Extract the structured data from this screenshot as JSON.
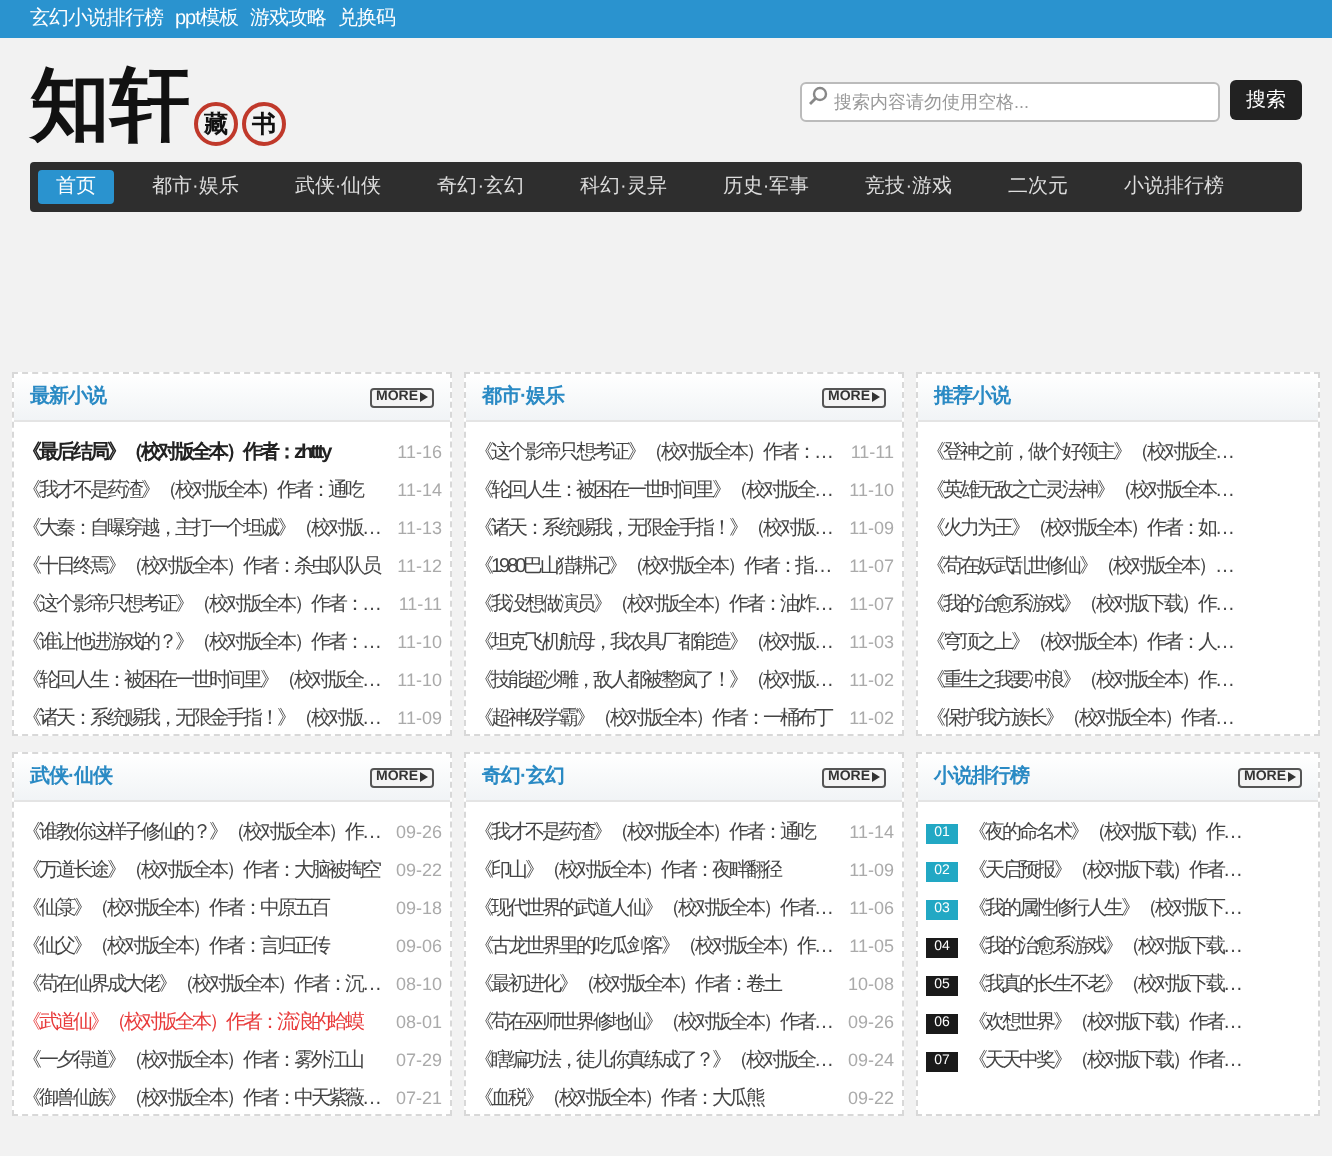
{
  "top_links": [
    "玄幻小说排行榜",
    "ppt模板",
    "游戏攻略",
    "兑换码"
  ],
  "logo": {
    "main": "知轩",
    "seals": [
      "藏",
      "书"
    ]
  },
  "search": {
    "placeholder": "搜索内容请勿使用空格...",
    "button": "搜索"
  },
  "nav": [
    {
      "label": "首页",
      "selected": true
    },
    {
      "label": "都市·娱乐",
      "selected": false
    },
    {
      "label": "武侠·仙侠",
      "selected": false
    },
    {
      "label": "奇幻·玄幻",
      "selected": false
    },
    {
      "label": "科幻·灵异",
      "selected": false
    },
    {
      "label": "历史·军事",
      "selected": false
    },
    {
      "label": "竞技·游戏",
      "selected": false
    },
    {
      "label": "二次元",
      "selected": false
    },
    {
      "label": "小说排行榜",
      "selected": false
    }
  ],
  "panels": [
    {
      "kind": "dated",
      "title": "最新小说",
      "more": "MORE",
      "items": [
        {
          "text": "《最后结局》（校对版全本）作者：zhttty",
          "date": "11-16",
          "bold": true,
          "highlighted": false
        },
        {
          "text": "《我才不是药渣》（校对版全本）作者：通吃",
          "date": "11-14",
          "bold": false,
          "highlighted": false
        },
        {
          "text": "《大秦：自曝穿越，主打一个坦诚》（校对版…",
          "date": "11-13",
          "bold": false,
          "highlighted": false
        },
        {
          "text": "《十日终焉》（校对版全本）作者：杀虫队队员",
          "date": "11-12",
          "bold": false,
          "highlighted": false
        },
        {
          "text": "《这个影帝只想考证》（校对版全本）作者：…",
          "date": "11-11",
          "bold": false,
          "highlighted": false
        },
        {
          "text": "《谁让他进游戏的？》（校对版全本）作者：…",
          "date": "11-10",
          "bold": false,
          "highlighted": false
        },
        {
          "text": "《轮回人生：被困在一世时间里》（校对版全…",
          "date": "11-10",
          "bold": false,
          "highlighted": false
        },
        {
          "text": "《诸天：系统赐我，无限金手指！》（校对版…",
          "date": "11-09",
          "bold": false,
          "highlighted": false
        }
      ]
    },
    {
      "kind": "dated",
      "title": "都市·娱乐",
      "more": "MORE",
      "items": [
        {
          "text": "《这个影帝只想考证》（校对版全本）作者：…",
          "date": "11-11",
          "bold": false,
          "highlighted": false
        },
        {
          "text": "《轮回人生：被困在一世时间里》（校对版全…",
          "date": "11-10",
          "bold": false,
          "highlighted": false
        },
        {
          "text": "《诸天：系统赐我，无限金手指！》（校对版…",
          "date": "11-09",
          "bold": false,
          "highlighted": false
        },
        {
          "text": "《1980巴山猎耕记》（校对版全本）作者：指…",
          "date": "11-07",
          "bold": false,
          "highlighted": false
        },
        {
          "text": "《我没想做演员》（校对版全本）作者：油炸…",
          "date": "11-07",
          "bold": false,
          "highlighted": false
        },
        {
          "text": "《坦克飞机航母，我农具厂都能造》（校对版…",
          "date": "11-03",
          "bold": false,
          "highlighted": false
        },
        {
          "text": "《技能超沙雕，敌人都被整疯了！》（校对版…",
          "date": "11-02",
          "bold": false,
          "highlighted": false
        },
        {
          "text": "《超神级学霸》（校对版全本）作者：一桶布丁",
          "date": "11-02",
          "bold": false,
          "highlighted": false
        }
      ]
    },
    {
      "kind": "plain",
      "title": "推荐小说",
      "items": [
        {
          "text": "《登神之前，做个好领主》（校对版全…"
        },
        {
          "text": "《英雄无敌之亡灵法神》（校对版全本…"
        },
        {
          "text": "《火力为王》（校对版全本）作者：如…"
        },
        {
          "text": "《苟在妖武乱世修仙》（校对版全本）…"
        },
        {
          "text": "《我的治愈系游戏》（校对版下载）作…"
        },
        {
          "text": "《穹顶之上》（校对版全本）作者：人…"
        },
        {
          "text": "《重生之我要冲浪》（校对版全本）作…"
        },
        {
          "text": "《保护我方族长》（校对版全本）作者…"
        }
      ]
    },
    {
      "kind": "dated",
      "title": "武侠·仙侠",
      "more": "MORE",
      "items": [
        {
          "text": "《谁教你这样子修仙的？》（校对版全本）作…",
          "date": "09-26",
          "bold": false,
          "highlighted": false
        },
        {
          "text": "《万道长途》（校对版全本）作者：大脑被掏空",
          "date": "09-22",
          "bold": false,
          "highlighted": false
        },
        {
          "text": "《仙箓》（校对版全本）作者：中原五百",
          "date": "09-18",
          "bold": false,
          "highlighted": false
        },
        {
          "text": "《仙父》（校对版全本）作者：言归正传",
          "date": "09-06",
          "bold": false,
          "highlighted": false
        },
        {
          "text": "《苟在仙界成大佬》（校对版全本）作者：沉…",
          "date": "08-10",
          "bold": false,
          "highlighted": false
        },
        {
          "text": "《武道仙》（校对版全本）作者：流浪的蛤蟆",
          "date": "08-01",
          "bold": false,
          "highlighted": true
        },
        {
          "text": "《一夕得道》（校对版全本）作者：雾外江山",
          "date": "07-29",
          "bold": false,
          "highlighted": false
        },
        {
          "text": "《御兽仙族》（校对版全本）作者：中天紫薇…",
          "date": "07-21",
          "bold": false,
          "highlighted": false
        }
      ]
    },
    {
      "kind": "dated",
      "title": "奇幻·玄幻",
      "more": "MORE",
      "items": [
        {
          "text": "《我才不是药渣》（校对版全本）作者：通吃",
          "date": "11-14",
          "bold": false,
          "highlighted": false
        },
        {
          "text": "《印山》（校对版全本）作者：夜畔翻径",
          "date": "11-09",
          "bold": false,
          "highlighted": false
        },
        {
          "text": "《现代世界的武道人仙》（校对版全本）作者…",
          "date": "11-06",
          "bold": false,
          "highlighted": false
        },
        {
          "text": "《古龙世界里的吃瓜剑客》（校对版全本）作…",
          "date": "11-05",
          "bold": false,
          "highlighted": false
        },
        {
          "text": "《最初进化》（校对版全本）作者：卷土",
          "date": "10-08",
          "bold": false,
          "highlighted": false
        },
        {
          "text": "《苟在巫师世界修地仙》（校对版全本）作者…",
          "date": "09-26",
          "bold": false,
          "highlighted": false
        },
        {
          "text": "《瞎编功法，徒儿你真练成了？》（校对版全…",
          "date": "09-24",
          "bold": false,
          "highlighted": false
        },
        {
          "text": "《血税》（校对版全本）作者：大瓜熊",
          "date": "09-22",
          "bold": false,
          "highlighted": false
        }
      ]
    },
    {
      "kind": "ranked",
      "title": "小说排行榜",
      "more": "MORE",
      "items": [
        {
          "rank": "01",
          "color": "#22a8c4",
          "text": "《夜的命名术》（校对版下载）作…"
        },
        {
          "rank": "02",
          "color": "#22a8c4",
          "text": "《天启预报》（校对版下载）作者…"
        },
        {
          "rank": "03",
          "color": "#22a8c4",
          "text": "《我的属性修行人生》（校对版下…"
        },
        {
          "rank": "04",
          "color": "#1a1a1a",
          "text": "《我的治愈系游戏》（校对版下载…"
        },
        {
          "rank": "05",
          "color": "#1a1a1a",
          "text": "《我真的长生不老》（校对版下载…"
        },
        {
          "rank": "06",
          "color": "#1a1a1a",
          "text": "《欢想世界》（校对版下载）作者…"
        },
        {
          "rank": "07",
          "color": "#1a1a1a",
          "text": "《天天中奖》（校对版下载）作者…"
        }
      ]
    }
  ]
}
